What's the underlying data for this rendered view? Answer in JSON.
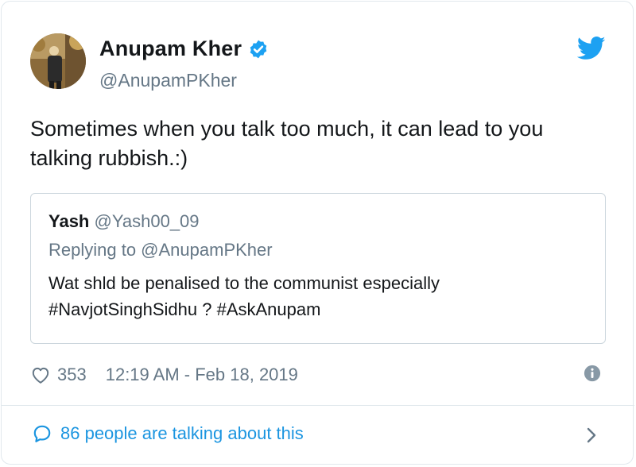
{
  "author": {
    "display_name": "Anupam Kher",
    "handle": "@AnupamPKher",
    "verified": true
  },
  "tweet": {
    "text": "Sometimes when you talk too much, it can lead to you talking rubbish.:)"
  },
  "quoted_tweet": {
    "display_name": "Yash",
    "handle": "@Yash00_09",
    "replying_to": "Replying to @AnupamPKher",
    "text": "Wat shld be penalised to the communist especially #NavjotSinghSidhu ? #AskAnupam"
  },
  "meta": {
    "likes": "353",
    "timestamp": "12:19 AM - Feb 18, 2019"
  },
  "conversation": {
    "label": "86 people are talking about this"
  },
  "colors": {
    "twitter_blue": "#1da1f2",
    "link_blue": "#1b95e0",
    "secondary_text": "#657786",
    "border": "#e1e8ed"
  },
  "icons": [
    "verified-badge-icon",
    "twitter-bird-icon",
    "heart-icon",
    "info-icon",
    "speech-bubble-icon",
    "chevron-right-icon"
  ]
}
